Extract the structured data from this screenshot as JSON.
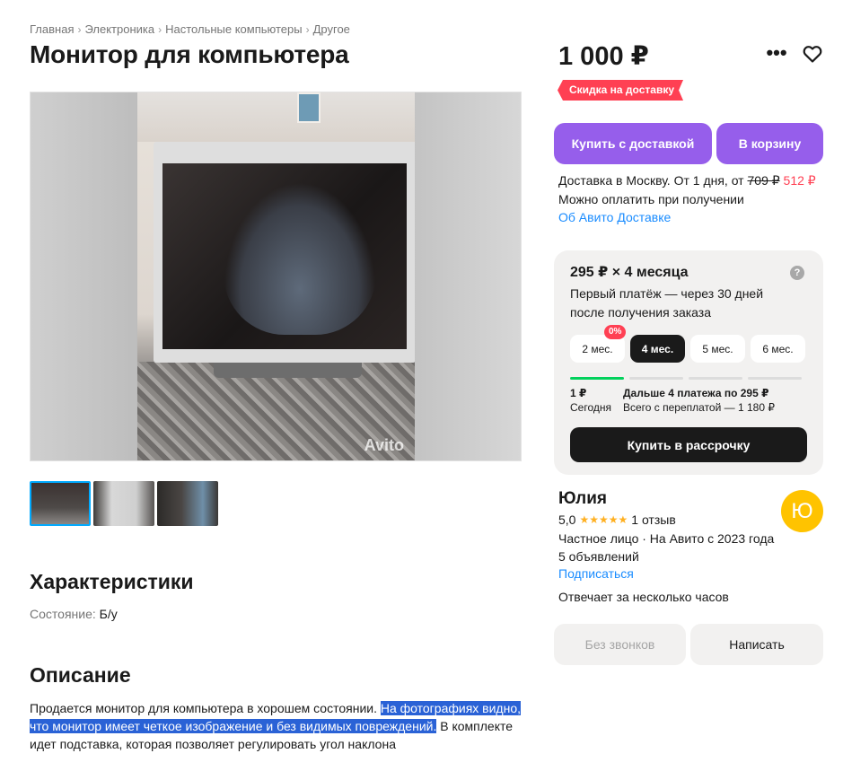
{
  "breadcrumb": [
    "Главная",
    "Электроника",
    "Настольные компьютеры",
    "Другое"
  ],
  "title": "Монитор для компьютера",
  "gallery": {
    "watermark": "Avito"
  },
  "characteristics": {
    "title": "Характеристики",
    "condition_label": "Состояние:",
    "condition_value": "Б/у"
  },
  "description": {
    "title": "Описание",
    "text_before": "Продается монитор для компьютера в хорошем состоянии. ",
    "text_selected": "На фотографиях видно, что монитор имеет четкое изображение и без видимых повреждений.",
    "text_after": " В комплекте идет подставка, которая позволяет регулировать угол наклона"
  },
  "price": "1 000 ₽",
  "badge": "Скидка на доставку",
  "buttons": {
    "buy_delivery": "Купить с доставкой",
    "to_cart": "В корзину",
    "buy_installment": "Купить в рассрочку",
    "no_calls": "Без звонков",
    "write": "Написать"
  },
  "delivery": {
    "line1_prefix": "Доставка в Москву. От 1 дня, от ",
    "old_price": "709 ₽",
    "new_price": "512 ₽",
    "line2": "Можно оплатить при получении",
    "link": "Об Авито Доставке"
  },
  "installment": {
    "title": "295 ₽ × 4 месяца",
    "subtitle": "Первый платёж — через 30 дней после получения заказа",
    "help_icon": "?",
    "terms": [
      "2 мес.",
      "4 мес.",
      "5 мес.",
      "6 мес."
    ],
    "active_term": "4 мес.",
    "zero_badge": "0%",
    "progress_paid_fraction": 0.25,
    "first_amount": "1 ₽",
    "first_label": "Сегодня",
    "rest_title": "Дальше 4 платежа по 295 ₽",
    "rest_total": "Всего с переплатой — 1 180 ₽"
  },
  "seller": {
    "name": "Юлия",
    "avatar_letter": "Ю",
    "avatar_color": "#ffc300",
    "rating": "5,0",
    "stars": "★★★★★",
    "reviews": "1 отзыв",
    "type": "Частное лицо · На Авито с 2023 года",
    "listings": "5 объявлений",
    "subscribe": "Подписаться",
    "response": "Отвечает за несколько часов"
  },
  "colors": {
    "accent_purple": "#965eeb",
    "discount_red": "#ff4053",
    "link_blue": "#1a8cff",
    "progress_green": "#02d15c"
  }
}
